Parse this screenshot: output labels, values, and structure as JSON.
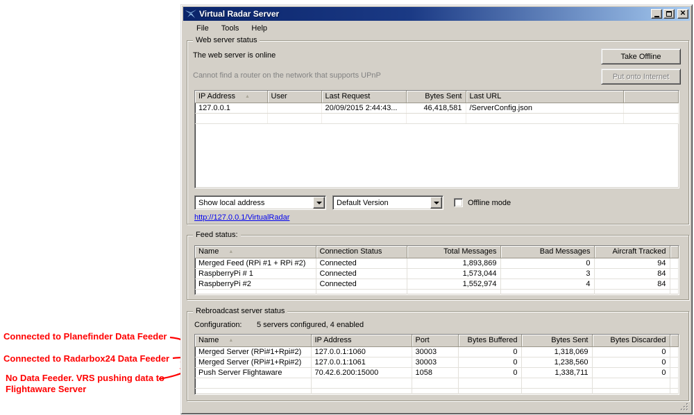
{
  "window": {
    "title": "Virtual Radar Server",
    "controls": {
      "minimize": "minimize",
      "maximize": "maximize",
      "close": "✕"
    }
  },
  "menu": {
    "items": [
      "File",
      "Tools",
      "Help"
    ]
  },
  "web_server": {
    "group_label": "Web server status",
    "status_text": "The web server is online",
    "take_offline_label": "Take Offline",
    "upnp_text": "Cannot find a router on the network that supports UPnP",
    "put_onto_internet_label": "Put onto Internet",
    "requests_table": {
      "columns": [
        "IP Address",
        "User",
        "Last Request",
        "Bytes Sent",
        "Last URL",
        ""
      ],
      "sort_column": 0,
      "rows": [
        [
          "127.0.0.1",
          "",
          "20/09/2015 2:44:43...",
          "46,418,581",
          "/ServerConfig.json",
          ""
        ]
      ],
      "trailing_empty_rows": 1
    },
    "address_select_value": "Show local address",
    "version_select_value": "Default Version",
    "offline_mode_label": "Offline mode",
    "offline_mode_checked": false,
    "link_text": "http://127.0.0.1/VirtualRadar"
  },
  "feed_status": {
    "group_label": "Feed status:",
    "table": {
      "columns": [
        "Name",
        "Connection Status",
        "Total Messages",
        "Bad Messages",
        "Aircraft Tracked",
        ""
      ],
      "sort_column": 0,
      "rows": [
        [
          "Merged Feed (RPi #1 + RPi #2)",
          "Connected",
          "1,893,869",
          "0",
          "94",
          ""
        ],
        [
          "RaspberryPi # 1",
          "Connected",
          "1,573,044",
          "3",
          "84",
          ""
        ],
        [
          "RaspberryPi #2",
          "Connected",
          "1,552,974",
          "4",
          "84",
          ""
        ]
      ],
      "trailing_empty_rows": 1
    }
  },
  "rebroadcast": {
    "group_label": "Rebroadcast server status",
    "configuration_label": "Configuration:",
    "configuration_value": "5 servers configured, 4 enabled",
    "table": {
      "columns": [
        "Name",
        "IP Address",
        "Port",
        "Bytes Buffered",
        "Bytes Sent",
        "Bytes Discarded",
        ""
      ],
      "sort_column": 0,
      "rows": [
        [
          "Merged Server (RPi#1+Rpi#2)",
          "127.0.0.1:1060",
          "30003",
          "0",
          "1,318,069",
          "0",
          ""
        ],
        [
          "Merged Server (RPi#1+Rpi#2)",
          "127.0.0.1:1061",
          "30003",
          "0",
          "1,238,560",
          "0",
          ""
        ],
        [
          "Push Server Flightaware",
          "70.42.6.200:15000",
          "1058",
          "0",
          "1,338,711",
          "0",
          ""
        ]
      ],
      "trailing_empty_rows": 2
    }
  },
  "annotations": {
    "items": [
      {
        "text": "Connected to Planefinder Data Feeder"
      },
      {
        "text": "Connected to Radarbox24 Data Feeder"
      },
      {
        "text": "No Data Feeder. VRS pushing data to Flightaware Server"
      }
    ]
  },
  "colors": {
    "titlebar_gradient_start": "#0a246a",
    "titlebar_gradient_end": "#a6caf0",
    "window_chrome": "#d4d0c8",
    "annotation_red": "#ff0000",
    "link_blue": "#0000ee",
    "disabled_text": "#808080"
  }
}
